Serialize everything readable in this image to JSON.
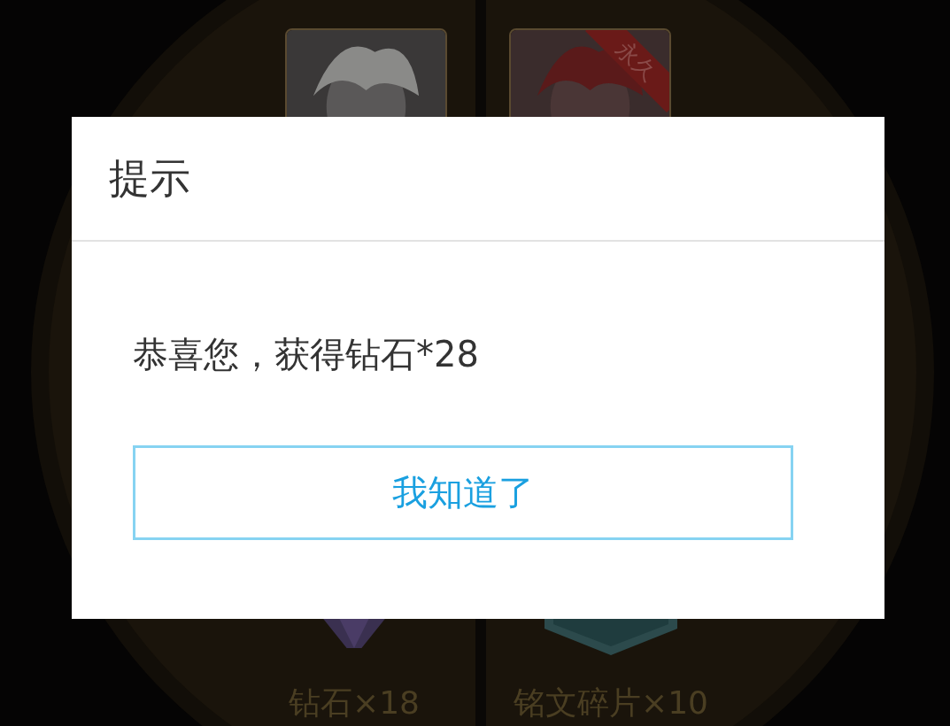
{
  "background": {
    "rewards": [
      {
        "kind": "picture"
      },
      {
        "kind": "picture",
        "tag": "永久"
      }
    ],
    "prizes": [
      {
        "label": "钻石×18",
        "kind": "gem"
      },
      {
        "label": "铭文碎片×10",
        "kind": "shard"
      }
    ]
  },
  "dialog": {
    "title": "提示",
    "message": "恭喜您，获得钻石*28",
    "button": "我知道了"
  }
}
